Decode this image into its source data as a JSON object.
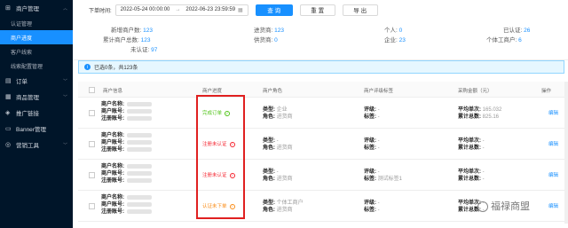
{
  "sidebar": {
    "groups": [
      {
        "label": "商户管理",
        "icon": "⊞",
        "expanded": true,
        "items": [
          {
            "label": "认证管理",
            "active": false
          },
          {
            "label": "商户进度",
            "active": true
          },
          {
            "label": "客户线索",
            "active": false
          },
          {
            "label": "线索配置管理",
            "active": false
          }
        ]
      },
      {
        "label": "订单",
        "icon": "▤"
      },
      {
        "label": "商品管理",
        "icon": "▦"
      },
      {
        "label": "推广链接",
        "icon": "◈"
      },
      {
        "label": "Banner管理",
        "icon": "▭"
      },
      {
        "label": "营销工具",
        "icon": "◎"
      }
    ]
  },
  "filter": {
    "label": "下单时间:",
    "date_start": "2022-05-24 00:00:00",
    "date_sep": "→",
    "date_end": "2022-06-23 23:59:59",
    "calendar_icon": "calendar-icon",
    "query_button": "查 询",
    "reset_button": "重 置",
    "export_button": "导 出"
  },
  "stats": {
    "new_merchants": {
      "label": "新增商户数:",
      "value": "123"
    },
    "cumulative_merchants": {
      "label": "累计商户总数:",
      "value": "123"
    },
    "unverified": {
      "label": "未认证:",
      "value": "97"
    },
    "goods_in": {
      "label": "进货商:",
      "value": "123"
    },
    "supplier": {
      "label": "供货商:",
      "value": "0"
    },
    "individual": {
      "label": "个人:",
      "value": "0"
    },
    "enterprise": {
      "label": "企业:",
      "value": "23"
    },
    "verified": {
      "label": "已认证:",
      "value": "26"
    },
    "individual_business": {
      "label": "个体工商户:",
      "value": "6"
    }
  },
  "info_bar": {
    "text": "已选0条，共123条"
  },
  "table": {
    "headers": [
      "商户信息",
      "商户进度",
      "商户角色",
      "商户评级标签",
      "采购金额（元）",
      "操作"
    ],
    "rows": [
      {
        "name_label": "商户名称:",
        "account_label": "商户账号:",
        "phone_label": "注册账号:",
        "status": "完成订单",
        "status_color": "green",
        "type_label": "类型:",
        "type_value": "企业",
        "role_label": "角色:",
        "role_value": "进货商",
        "rating_label": "评级:",
        "rating_value": "-",
        "tag_label": "标签:",
        "tag_value": "-",
        "avg_label": "平均单次:",
        "avg_value": "165.032",
        "total_label": "累计总数:",
        "total_value": "825.16",
        "action": "编辑"
      },
      {
        "name_label": "商户名称:",
        "account_label": "商户账号:",
        "phone_label": "注册账号:",
        "status": "注册未认证",
        "status_color": "red",
        "type_label": "类型:",
        "type_value": "-",
        "role_label": "角色:",
        "role_value": "进货商",
        "rating_label": "评级:",
        "rating_value": "-",
        "tag_label": "标签:",
        "tag_value": "-",
        "avg_label": "平均单次:",
        "avg_value": "-",
        "total_label": "累计总数:",
        "total_value": "-",
        "action": "编辑"
      },
      {
        "name_label": "商户名称:",
        "account_label": "商户账号:",
        "phone_label": "注册账号:",
        "status": "注册未认证",
        "status_color": "red",
        "type_label": "类型:",
        "type_value": "-",
        "role_label": "角色:",
        "role_value": "进货商",
        "rating_label": "评级:",
        "rating_value": "-",
        "tag_label": "标签:",
        "tag_value": "测试标签1",
        "avg_label": "平均单次:",
        "avg_value": "-",
        "total_label": "累计总数:",
        "total_value": "-",
        "action": "编辑"
      },
      {
        "name_label": "商户名称:",
        "account_label": "商户账号:",
        "phone_label": "注册账号:",
        "status": "认证未下单",
        "status_color": "orange",
        "type_label": "类型:",
        "type_value": "个体工商户",
        "role_label": "角色:",
        "role_value": "进货商",
        "rating_label": "评级:",
        "rating_value": "-",
        "tag_label": "标签:",
        "tag_value": "-",
        "avg_label": "平均单次:",
        "avg_value": "-",
        "total_label": "累计总数:",
        "total_value": "-",
        "action": "编辑"
      }
    ]
  },
  "watermark": {
    "text": "福禄商盟"
  },
  "colors": {
    "primary": "#1890ff",
    "sidebar": "#001529",
    "highlight": "#e02020"
  }
}
